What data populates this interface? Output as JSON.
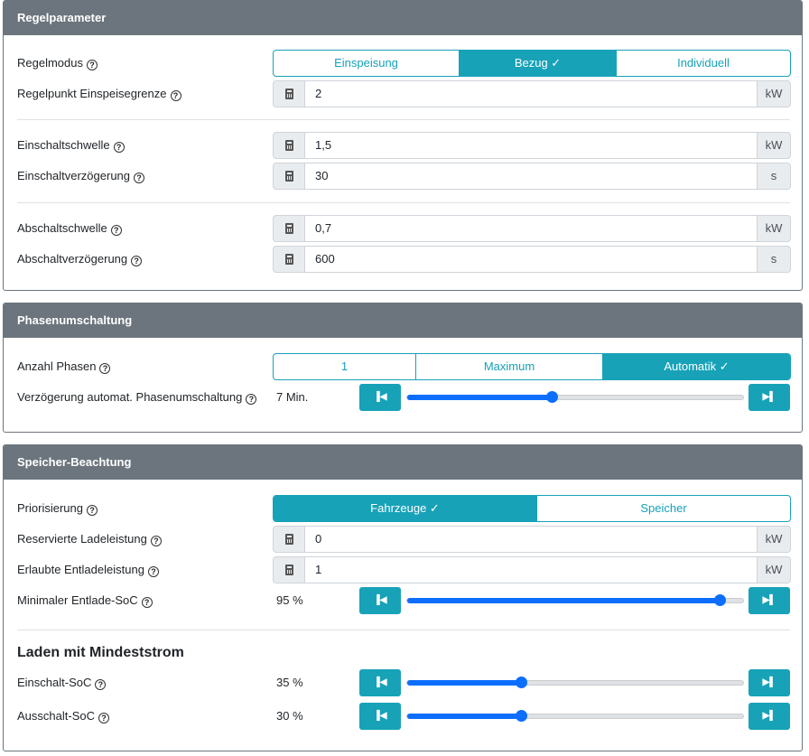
{
  "regel": {
    "title": "Regelparameter",
    "modus_label": "Regelmodus",
    "modus_options": [
      "Einspeisung",
      "Bezug ✓",
      "Individuell"
    ],
    "punkt_label": "Regelpunkt Einspeisegrenze",
    "punkt_value": "2",
    "punkt_unit": "kW",
    "ein_schwelle_label": "Einschaltschwelle",
    "ein_schwelle_value": "1,5",
    "ein_schwelle_unit": "kW",
    "ein_verz_label": "Einschaltverzögerung",
    "ein_verz_value": "30",
    "ein_verz_unit": "s",
    "aus_schwelle_label": "Abschaltschwelle",
    "aus_schwelle_value": "0,7",
    "aus_schwelle_unit": "kW",
    "aus_verz_label": "Abschaltverzögerung",
    "aus_verz_value": "600",
    "aus_verz_unit": "s"
  },
  "phasen": {
    "title": "Phasenumschaltung",
    "anzahl_label": "Anzahl Phasen",
    "anzahl_options": [
      "1",
      "Maximum",
      "Automatik ✓"
    ],
    "verz_label": "Verzögerung automat. Phasenumschaltung",
    "verz_value": "7 Min.",
    "verz_fraction": 0.43
  },
  "speicher": {
    "title": "Speicher-Beachtung",
    "prio_label": "Priorisierung",
    "prio_options": [
      "Fahrzeuge ✓",
      "Speicher"
    ],
    "res_label": "Reservierte Ladeleistung",
    "res_value": "0",
    "res_unit": "kW",
    "ent_label": "Erlaubte Entladeleistung",
    "ent_value": "1",
    "ent_unit": "kW",
    "soc_label": "Minimaler Entlade-SoC",
    "soc_value": "95 %",
    "soc_fraction": 0.93,
    "min_heading": "Laden mit Mindeststrom",
    "ein_soc_label": "Einschalt-SoC",
    "ein_soc_value": "35 %",
    "ein_soc_fraction": 0.34,
    "aus_soc_label": "Ausschalt-SoC",
    "aus_soc_value": "30 %",
    "aus_soc_fraction": 0.34
  },
  "icons": {
    "help": "?",
    "prev": "⏮",
    "next": "⏭"
  }
}
